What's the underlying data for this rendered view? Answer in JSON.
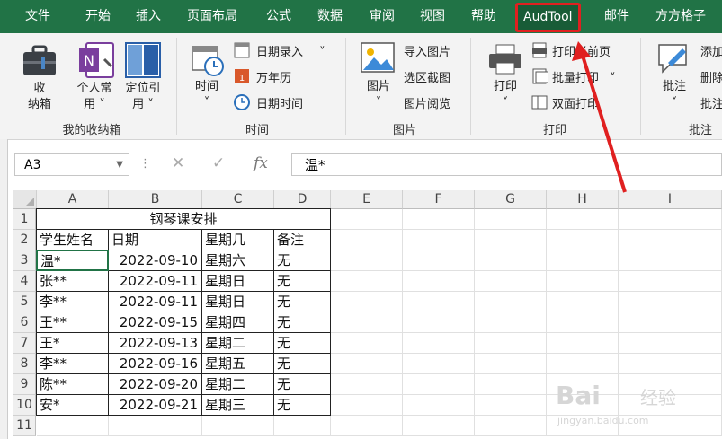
{
  "tabs": [
    "文件",
    "开始",
    "插入",
    "页面布局",
    "公式",
    "数据",
    "审阅",
    "视图",
    "帮助",
    "AudTool",
    "邮件",
    "方方格子"
  ],
  "ribbon": {
    "toolbox": {
      "label_line1": "收",
      "label_line2": "纳箱",
      "personal": "个人常",
      "personal2": "用",
      "locate": "定位引",
      "locate2": "用",
      "group": "我的收纳箱"
    },
    "time": {
      "big": "时间",
      "date_entry": "日期录入",
      "calendar": "万年历",
      "datetime": "日期时间",
      "group": "时间"
    },
    "picture": {
      "big": "图片",
      "import": "导入图片",
      "screenshot": "选区截图",
      "browse": "图片阅览",
      "group": "图片"
    },
    "print": {
      "big": "打印",
      "current": "打印当前页",
      "batch": "批量打印",
      "duplex": "双面打印",
      "group": "打印"
    },
    "comment": {
      "big": "批注",
      "add": "添加",
      "delete": "删除",
      "batch": "批注",
      "group": "批注"
    }
  },
  "formula_bar": {
    "name_box": "A3",
    "formula": "温*"
  },
  "columns": [
    "A",
    "B",
    "C",
    "D",
    "E",
    "F",
    "G",
    "H",
    "I"
  ],
  "rows": [
    "1",
    "2",
    "3",
    "4",
    "5",
    "6",
    "7",
    "8",
    "9",
    "10",
    "11"
  ],
  "sheet": {
    "title": "钢琴课安排",
    "headers": [
      "学生姓名",
      "日期",
      "星期几",
      "备注"
    ],
    "records": [
      [
        "温*",
        "2022-09-10",
        "星期六",
        "无"
      ],
      [
        "张**",
        "2022-09-11",
        "星期日",
        "无"
      ],
      [
        "李**",
        "2022-09-11",
        "星期日",
        "无"
      ],
      [
        "王**",
        "2022-09-15",
        "星期四",
        "无"
      ],
      [
        "王*",
        "2022-09-13",
        "星期二",
        "无"
      ],
      [
        "李**",
        "2022-09-16",
        "星期五",
        "无"
      ],
      [
        "陈**",
        "2022-09-20",
        "星期二",
        "无"
      ],
      [
        "安*",
        "2022-09-21",
        "星期三",
        "无"
      ]
    ]
  },
  "colors": {
    "excel_green": "#217346",
    "highlight_red": "#e02020"
  },
  "watermark": "Bai du 经验 jingyan.baidu.com"
}
